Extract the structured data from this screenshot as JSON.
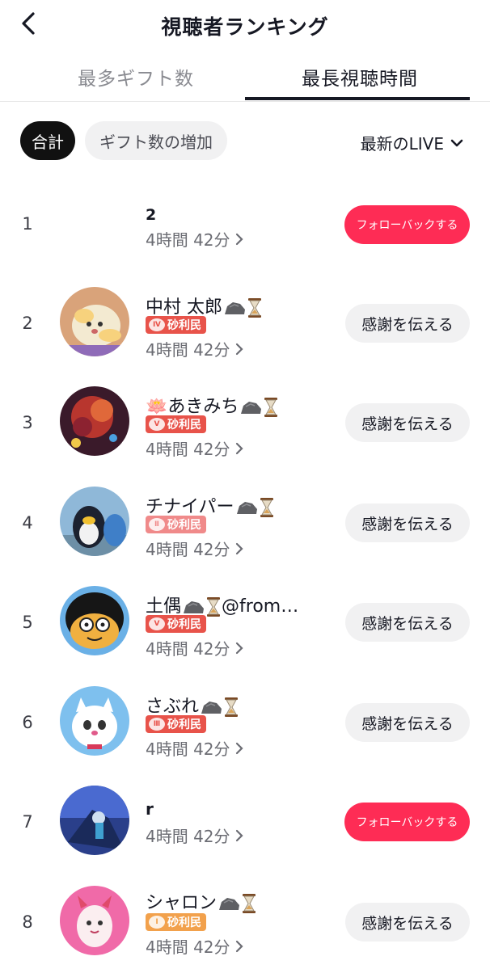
{
  "header": {
    "title": "視聴者ランキング",
    "back_icon": "chevron-left-icon"
  },
  "tabs": [
    {
      "label": "最多ギフト数",
      "active": false
    },
    {
      "label": "最長視聴時間",
      "active": true
    }
  ],
  "filters": {
    "total_label": "合計",
    "gift_increase_label": "ギフト数の増加",
    "sort_label": "最新のLIVE",
    "sort_icon": "chevron-down-icon"
  },
  "colors": {
    "follow": "#fe2c55",
    "badge_red": "#e8534a",
    "badge_pink": "#f08a8a",
    "badge_orange": "#f2a14c"
  },
  "viewers": [
    {
      "rank": "1",
      "name": "2",
      "badge": "",
      "time": "4時間 42分",
      "action": "フォローバックする",
      "action_type": "follow"
    },
    {
      "rank": "2",
      "name": "中村 太郎",
      "badge": "砂利民",
      "badge_level": "Ⅳ",
      "time": "4時間 42分",
      "action": "感謝を伝える",
      "action_type": "thank"
    },
    {
      "rank": "3",
      "name": "🪷あきみち",
      "badge": "砂利民",
      "badge_level": "Ⅴ",
      "time": "4時間 42分",
      "action": "感謝を伝える",
      "action_type": "thank"
    },
    {
      "rank": "4",
      "name": "チナイパー",
      "badge": "砂利民",
      "badge_level": "Ⅱ",
      "time": "4時間 42分",
      "action": "感謝を伝える",
      "action_type": "thank"
    },
    {
      "rank": "5",
      "name": "土偶",
      "name_suffix": "@from…",
      "badge": "砂利民",
      "badge_level": "Ⅴ",
      "time": "4時間 42分",
      "action": "感謝を伝える",
      "action_type": "thank"
    },
    {
      "rank": "6",
      "name": "さぶれ",
      "badge": "砂利民",
      "badge_level": "Ⅲ",
      "time": "4時間 42分",
      "action": "感謝を伝える",
      "action_type": "thank"
    },
    {
      "rank": "7",
      "name": "r",
      "badge": "",
      "time": "4時間 42分",
      "action": "フォローバックする",
      "action_type": "follow"
    },
    {
      "rank": "8",
      "name": "シャロン",
      "badge": "砂利民",
      "badge_level": "Ⅰ",
      "time": "4時間 42分",
      "action": "感謝を伝える",
      "action_type": "thank"
    }
  ]
}
